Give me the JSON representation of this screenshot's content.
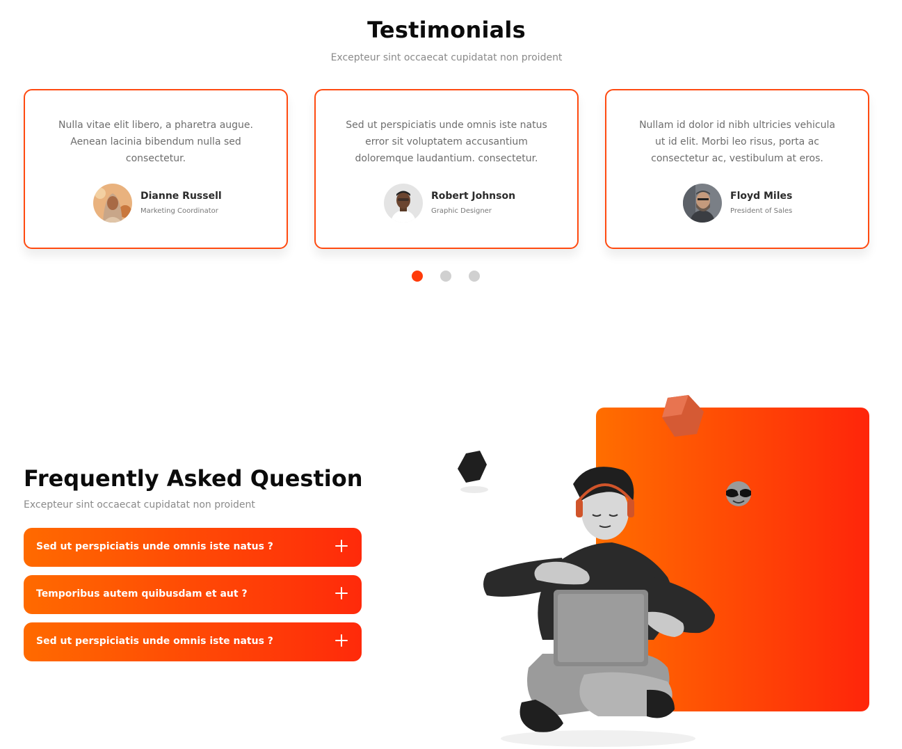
{
  "testimonials": {
    "title": "Testimonials",
    "subtitle": "Excepteur sint occaecat cupidatat non proident",
    "cards": [
      {
        "quote": "Nulla vitae elit libero, a pharetra augue. Aenean lacinia bibendum nulla sed consectetur.",
        "name": "Dianne Russell",
        "role": "Marketing Coordinator"
      },
      {
        "quote": "Sed ut perspiciatis unde omnis iste natus error sit voluptatem accusantium doloremque laudantium. consectetur.",
        "name": "Robert Johnson",
        "role": "Graphic Designer"
      },
      {
        "quote": "Nullam id dolor id nibh ultricies vehicula ut id elit. Morbi leo risus, porta ac consectetur ac, vestibulum at eros.",
        "name": "Floyd Miles",
        "role": "President of Sales"
      }
    ],
    "active_slide": 1,
    "slide_count": 3
  },
  "faq": {
    "title": "Frequently Asked Question",
    "subtitle": "Excepteur sint occaecat cupidatat non proident",
    "items": [
      {
        "question": "Sed ut perspiciatis unde omnis iste natus ?"
      },
      {
        "question": "Temporibus autem quibusdam et aut ?"
      },
      {
        "question": "Sed ut perspiciatis unde omnis iste natus ?"
      }
    ]
  },
  "colors": {
    "accent": "#ff4a10",
    "gradient_start": "#ff6a00",
    "gradient_end": "#ff250a",
    "dot_inactive": "#d0d0d0"
  },
  "icons": {
    "expand": "plus-icon"
  }
}
